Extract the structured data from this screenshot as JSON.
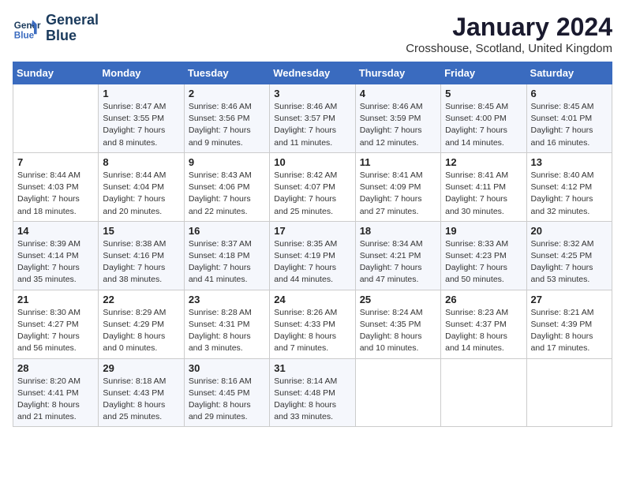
{
  "header": {
    "logo_line1": "General",
    "logo_line2": "Blue",
    "title": "January 2024",
    "subtitle": "Crosshouse, Scotland, United Kingdom"
  },
  "days_of_week": [
    "Sunday",
    "Monday",
    "Tuesday",
    "Wednesday",
    "Thursday",
    "Friday",
    "Saturday"
  ],
  "weeks": [
    [
      {
        "day": "",
        "sunrise": "",
        "sunset": "",
        "daylight": ""
      },
      {
        "day": "1",
        "sunrise": "Sunrise: 8:47 AM",
        "sunset": "Sunset: 3:55 PM",
        "daylight": "Daylight: 7 hours and 8 minutes."
      },
      {
        "day": "2",
        "sunrise": "Sunrise: 8:46 AM",
        "sunset": "Sunset: 3:56 PM",
        "daylight": "Daylight: 7 hours and 9 minutes."
      },
      {
        "day": "3",
        "sunrise": "Sunrise: 8:46 AM",
        "sunset": "Sunset: 3:57 PM",
        "daylight": "Daylight: 7 hours and 11 minutes."
      },
      {
        "day": "4",
        "sunrise": "Sunrise: 8:46 AM",
        "sunset": "Sunset: 3:59 PM",
        "daylight": "Daylight: 7 hours and 12 minutes."
      },
      {
        "day": "5",
        "sunrise": "Sunrise: 8:45 AM",
        "sunset": "Sunset: 4:00 PM",
        "daylight": "Daylight: 7 hours and 14 minutes."
      },
      {
        "day": "6",
        "sunrise": "Sunrise: 8:45 AM",
        "sunset": "Sunset: 4:01 PM",
        "daylight": "Daylight: 7 hours and 16 minutes."
      }
    ],
    [
      {
        "day": "7",
        "sunrise": "Sunrise: 8:44 AM",
        "sunset": "Sunset: 4:03 PM",
        "daylight": "Daylight: 7 hours and 18 minutes."
      },
      {
        "day": "8",
        "sunrise": "Sunrise: 8:44 AM",
        "sunset": "Sunset: 4:04 PM",
        "daylight": "Daylight: 7 hours and 20 minutes."
      },
      {
        "day": "9",
        "sunrise": "Sunrise: 8:43 AM",
        "sunset": "Sunset: 4:06 PM",
        "daylight": "Daylight: 7 hours and 22 minutes."
      },
      {
        "day": "10",
        "sunrise": "Sunrise: 8:42 AM",
        "sunset": "Sunset: 4:07 PM",
        "daylight": "Daylight: 7 hours and 25 minutes."
      },
      {
        "day": "11",
        "sunrise": "Sunrise: 8:41 AM",
        "sunset": "Sunset: 4:09 PM",
        "daylight": "Daylight: 7 hours and 27 minutes."
      },
      {
        "day": "12",
        "sunrise": "Sunrise: 8:41 AM",
        "sunset": "Sunset: 4:11 PM",
        "daylight": "Daylight: 7 hours and 30 minutes."
      },
      {
        "day": "13",
        "sunrise": "Sunrise: 8:40 AM",
        "sunset": "Sunset: 4:12 PM",
        "daylight": "Daylight: 7 hours and 32 minutes."
      }
    ],
    [
      {
        "day": "14",
        "sunrise": "Sunrise: 8:39 AM",
        "sunset": "Sunset: 4:14 PM",
        "daylight": "Daylight: 7 hours and 35 minutes."
      },
      {
        "day": "15",
        "sunrise": "Sunrise: 8:38 AM",
        "sunset": "Sunset: 4:16 PM",
        "daylight": "Daylight: 7 hours and 38 minutes."
      },
      {
        "day": "16",
        "sunrise": "Sunrise: 8:37 AM",
        "sunset": "Sunset: 4:18 PM",
        "daylight": "Daylight: 7 hours and 41 minutes."
      },
      {
        "day": "17",
        "sunrise": "Sunrise: 8:35 AM",
        "sunset": "Sunset: 4:19 PM",
        "daylight": "Daylight: 7 hours and 44 minutes."
      },
      {
        "day": "18",
        "sunrise": "Sunrise: 8:34 AM",
        "sunset": "Sunset: 4:21 PM",
        "daylight": "Daylight: 7 hours and 47 minutes."
      },
      {
        "day": "19",
        "sunrise": "Sunrise: 8:33 AM",
        "sunset": "Sunset: 4:23 PM",
        "daylight": "Daylight: 7 hours and 50 minutes."
      },
      {
        "day": "20",
        "sunrise": "Sunrise: 8:32 AM",
        "sunset": "Sunset: 4:25 PM",
        "daylight": "Daylight: 7 hours and 53 minutes."
      }
    ],
    [
      {
        "day": "21",
        "sunrise": "Sunrise: 8:30 AM",
        "sunset": "Sunset: 4:27 PM",
        "daylight": "Daylight: 7 hours and 56 minutes."
      },
      {
        "day": "22",
        "sunrise": "Sunrise: 8:29 AM",
        "sunset": "Sunset: 4:29 PM",
        "daylight": "Daylight: 8 hours and 0 minutes."
      },
      {
        "day": "23",
        "sunrise": "Sunrise: 8:28 AM",
        "sunset": "Sunset: 4:31 PM",
        "daylight": "Daylight: 8 hours and 3 minutes."
      },
      {
        "day": "24",
        "sunrise": "Sunrise: 8:26 AM",
        "sunset": "Sunset: 4:33 PM",
        "daylight": "Daylight: 8 hours and 7 minutes."
      },
      {
        "day": "25",
        "sunrise": "Sunrise: 8:24 AM",
        "sunset": "Sunset: 4:35 PM",
        "daylight": "Daylight: 8 hours and 10 minutes."
      },
      {
        "day": "26",
        "sunrise": "Sunrise: 8:23 AM",
        "sunset": "Sunset: 4:37 PM",
        "daylight": "Daylight: 8 hours and 14 minutes."
      },
      {
        "day": "27",
        "sunrise": "Sunrise: 8:21 AM",
        "sunset": "Sunset: 4:39 PM",
        "daylight": "Daylight: 8 hours and 17 minutes."
      }
    ],
    [
      {
        "day": "28",
        "sunrise": "Sunrise: 8:20 AM",
        "sunset": "Sunset: 4:41 PM",
        "daylight": "Daylight: 8 hours and 21 minutes."
      },
      {
        "day": "29",
        "sunrise": "Sunrise: 8:18 AM",
        "sunset": "Sunset: 4:43 PM",
        "daylight": "Daylight: 8 hours and 25 minutes."
      },
      {
        "day": "30",
        "sunrise": "Sunrise: 8:16 AM",
        "sunset": "Sunset: 4:45 PM",
        "daylight": "Daylight: 8 hours and 29 minutes."
      },
      {
        "day": "31",
        "sunrise": "Sunrise: 8:14 AM",
        "sunset": "Sunset: 4:48 PM",
        "daylight": "Daylight: 8 hours and 33 minutes."
      },
      {
        "day": "",
        "sunrise": "",
        "sunset": "",
        "daylight": ""
      },
      {
        "day": "",
        "sunrise": "",
        "sunset": "",
        "daylight": ""
      },
      {
        "day": "",
        "sunrise": "",
        "sunset": "",
        "daylight": ""
      }
    ]
  ]
}
